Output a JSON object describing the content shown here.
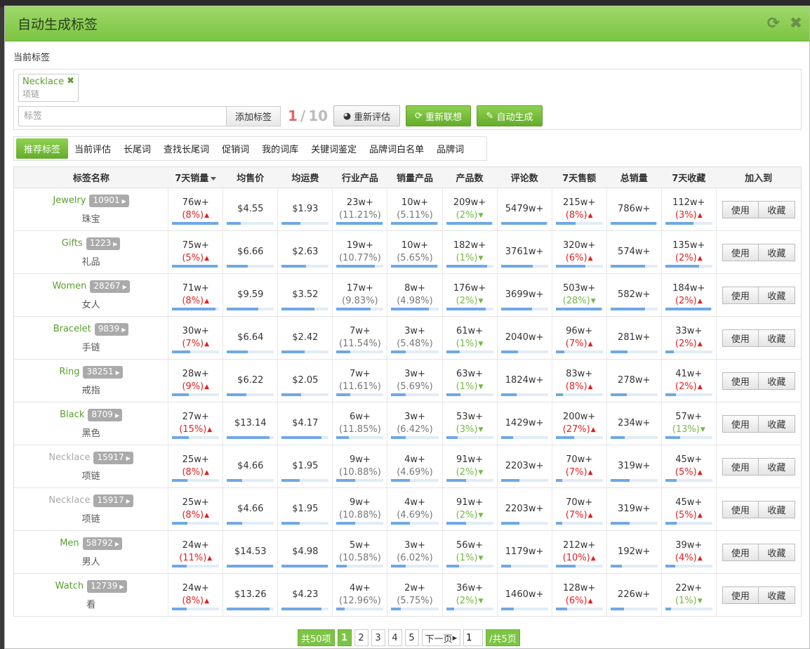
{
  "modal": {
    "title": "自动生成标签",
    "refresh_icon": "refresh-icon",
    "close_icon": "close-icon"
  },
  "current_tags": {
    "section_label": "当前标签",
    "chips": [
      {
        "en": "Necklace",
        "cn": "项链"
      }
    ],
    "input_placeholder": "标签",
    "add_button": "添加标签",
    "count_current": "1",
    "count_sep": "/",
    "count_max": "10",
    "reeval_button": "重新评估",
    "relate_button": "重新联想",
    "auto_button": "自动生成"
  },
  "tabs": [
    "推荐标签",
    "当前评估",
    "长尾词",
    "查找长尾词",
    "促销词",
    "我的词库",
    "关键词鉴定",
    "品牌词白名单",
    "品牌词"
  ],
  "active_tab": 0,
  "table": {
    "headers": [
      "标签名称",
      "7天销量",
      "均售价",
      "均运费",
      "行业产品",
      "销量产品",
      "产品数",
      "评论数",
      "7天售额",
      "总销量",
      "7天收藏",
      "加入到"
    ],
    "use_label": "使用",
    "fav_label": "收藏",
    "rows": [
      {
        "en": "Jewelry",
        "count": "10901",
        "cn": "珠宝",
        "muted": false,
        "sales7": "76w+",
        "sales7_ch": "(8%)",
        "sales7_dir": "up",
        "sales7_bar": 0.98,
        "price": "$4.55",
        "price_bar": 0.3,
        "ship": "$1.93",
        "ship_bar": 0.4,
        "ind": "23w+",
        "ind_ch": "(11.21%)",
        "ind_bar": 0.98,
        "sold": "10w+",
        "sold_ch": "(5.11%)",
        "sold_bar": 0.98,
        "prod": "209w+",
        "prod_ch": "(2%)",
        "prod_dir": "down",
        "prod_bar": 0.98,
        "reviews": "5479w+",
        "rev_bar": 0.98,
        "rev7": "215w+",
        "rev7_ch": "(8%)",
        "rev7_dir": "up",
        "rev7_bar": 0.43,
        "total": "786w+",
        "total_bar": 0.98,
        "fav": "112w+",
        "fav_ch": "(3%)",
        "fav_dir": "up",
        "fav_bar": 0.6
      },
      {
        "en": "Gifts",
        "count": "1223",
        "cn": "礼品",
        "muted": false,
        "sales7": "75w+",
        "sales7_ch": "(5%)",
        "sales7_dir": "up",
        "sales7_bar": 0.97,
        "price": "$6.66",
        "price_bar": 0.45,
        "ship": "$2.63",
        "ship_bar": 0.52,
        "ind": "19w+",
        "ind_ch": "(10.77%)",
        "ind_bar": 0.82,
        "sold": "10w+",
        "sold_ch": "(5.65%)",
        "sold_bar": 0.98,
        "prod": "182w+",
        "prod_ch": "(1%)",
        "prod_dir": "down",
        "prod_bar": 0.87,
        "reviews": "3761w+",
        "rev_bar": 0.68,
        "rev7": "320w+",
        "rev7_ch": "(6%)",
        "rev7_dir": "up",
        "rev7_bar": 0.63,
        "total": "574w+",
        "total_bar": 0.73,
        "fav": "135w+",
        "fav_ch": "(2%)",
        "fav_dir": "up",
        "fav_bar": 0.72
      },
      {
        "en": "Women",
        "count": "28267",
        "cn": "女人",
        "muted": false,
        "sales7": "71w+",
        "sales7_ch": "(8%)",
        "sales7_dir": "up",
        "sales7_bar": 0.92,
        "price": "$9.59",
        "price_bar": 0.66,
        "ship": "$3.52",
        "ship_bar": 0.7,
        "ind": "17w+",
        "ind_ch": "(9.83%)",
        "ind_bar": 0.73,
        "sold": "8w+",
        "sold_ch": "(4.98%)",
        "sold_bar": 0.8,
        "prod": "176w+",
        "prod_ch": "(2%)",
        "prod_dir": "down",
        "prod_bar": 0.84,
        "reviews": "3699w+",
        "rev_bar": 0.67,
        "rev7": "503w+",
        "rev7_ch": "(28%)",
        "rev7_dir": "down",
        "rev7_bar": 0.98,
        "total": "582w+",
        "total_bar": 0.74,
        "fav": "184w+",
        "fav_ch": "(2%)",
        "fav_dir": "up",
        "fav_bar": 0.98
      },
      {
        "en": "Bracelet",
        "count": "9839",
        "cn": "手链",
        "muted": false,
        "sales7": "30w+",
        "sales7_ch": "(7%)",
        "sales7_dir": "up",
        "sales7_bar": 0.39,
        "price": "$6.64",
        "price_bar": 0.45,
        "ship": "$2.42",
        "ship_bar": 0.48,
        "ind": "7w+",
        "ind_ch": "(11.54%)",
        "ind_bar": 0.3,
        "sold": "3w+",
        "sold_ch": "(5.48%)",
        "sold_bar": 0.3,
        "prod": "61w+",
        "prod_ch": "(1%)",
        "prod_dir": "down",
        "prod_bar": 0.29,
        "reviews": "2040w+",
        "rev_bar": 0.37,
        "rev7": "96w+",
        "rev7_ch": "(7%)",
        "rev7_dir": "up",
        "rev7_bar": 0.19,
        "total": "281w+",
        "total_bar": 0.36,
        "fav": "33w+",
        "fav_ch": "(2%)",
        "fav_dir": "up",
        "fav_bar": 0.18
      },
      {
        "en": "Ring",
        "count": "38251",
        "cn": "戒指",
        "muted": false,
        "sales7": "28w+",
        "sales7_ch": "(9%)",
        "sales7_dir": "up",
        "sales7_bar": 0.36,
        "price": "$6.22",
        "price_bar": 0.42,
        "ship": "$2.05",
        "ship_bar": 0.41,
        "ind": "7w+",
        "ind_ch": "(11.61%)",
        "ind_bar": 0.3,
        "sold": "3w+",
        "sold_ch": "(5.69%)",
        "sold_bar": 0.3,
        "prod": "63w+",
        "prod_ch": "(1%)",
        "prod_dir": "down",
        "prod_bar": 0.3,
        "reviews": "1824w+",
        "rev_bar": 0.33,
        "rev7": "83w+",
        "rev7_ch": "(8%)",
        "rev7_dir": "up",
        "rev7_bar": 0.16,
        "total": "278w+",
        "total_bar": 0.35,
        "fav": "41w+",
        "fav_ch": "(2%)",
        "fav_dir": "up",
        "fav_bar": 0.22
      },
      {
        "en": "Black",
        "count": "8709",
        "cn": "黑色",
        "muted": false,
        "sales7": "27w+",
        "sales7_ch": "(15%)",
        "sales7_dir": "up",
        "sales7_bar": 0.35,
        "price": "$13.14",
        "price_bar": 0.9,
        "ship": "$4.17",
        "ship_bar": 0.84,
        "ind": "6w+",
        "ind_ch": "(11.85%)",
        "ind_bar": 0.26,
        "sold": "3w+",
        "sold_ch": "(6.42%)",
        "sold_bar": 0.3,
        "prod": "53w+",
        "prod_ch": "(3%)",
        "prod_dir": "down",
        "prod_bar": 0.25,
        "reviews": "1429w+",
        "rev_bar": 0.26,
        "rev7": "200w+",
        "rev7_ch": "(27%)",
        "rev7_dir": "up",
        "rev7_bar": 0.4,
        "total": "234w+",
        "total_bar": 0.3,
        "fav": "57w+",
        "fav_ch": "(13%)",
        "fav_dir": "down",
        "fav_bar": 0.31
      },
      {
        "en": "Necklace",
        "count": "15917",
        "cn": "项链",
        "muted": true,
        "sales7": "25w+",
        "sales7_ch": "(8%)",
        "sales7_dir": "up",
        "sales7_bar": 0.32,
        "price": "$4.66",
        "price_bar": 0.32,
        "ship": "$1.95",
        "ship_bar": 0.39,
        "ind": "9w+",
        "ind_ch": "(10.88%)",
        "ind_bar": 0.39,
        "sold": "4w+",
        "sold_ch": "(4.69%)",
        "sold_bar": 0.4,
        "prod": "91w+",
        "prod_ch": "(2%)",
        "prod_dir": "down",
        "prod_bar": 0.43,
        "reviews": "2203w+",
        "rev_bar": 0.4,
        "rev7": "70w+",
        "rev7_ch": "(7%)",
        "rev7_dir": "up",
        "rev7_bar": 0.14,
        "total": "319w+",
        "total_bar": 0.41,
        "fav": "45w+",
        "fav_ch": "(5%)",
        "fav_dir": "up",
        "fav_bar": 0.24
      },
      {
        "en": "Necklace",
        "count": "15917",
        "cn": "项链",
        "muted": true,
        "sales7": "25w+",
        "sales7_ch": "(8%)",
        "sales7_dir": "up",
        "sales7_bar": 0.32,
        "price": "$4.66",
        "price_bar": 0.32,
        "ship": "$1.95",
        "ship_bar": 0.39,
        "ind": "9w+",
        "ind_ch": "(10.88%)",
        "ind_bar": 0.39,
        "sold": "4w+",
        "sold_ch": "(4.69%)",
        "sold_bar": 0.4,
        "prod": "91w+",
        "prod_ch": "(2%)",
        "prod_dir": "down",
        "prod_bar": 0.43,
        "reviews": "2203w+",
        "rev_bar": 0.4,
        "rev7": "70w+",
        "rev7_ch": "(7%)",
        "rev7_dir": "up",
        "rev7_bar": 0.14,
        "total": "319w+",
        "total_bar": 0.41,
        "fav": "45w+",
        "fav_ch": "(5%)",
        "fav_dir": "up",
        "fav_bar": 0.24
      },
      {
        "en": "Men",
        "count": "58792",
        "cn": "男人",
        "muted": false,
        "sales7": "24w+",
        "sales7_ch": "(11%)",
        "sales7_dir": "up",
        "sales7_bar": 0.31,
        "price": "$14.53",
        "price_bar": 0.98,
        "ship": "$4.98",
        "ship_bar": 0.98,
        "ind": "5w+",
        "ind_ch": "(10.58%)",
        "ind_bar": 0.22,
        "sold": "3w+",
        "sold_ch": "(6.02%)",
        "sold_bar": 0.3,
        "prod": "56w+",
        "prod_ch": "(1%)",
        "prod_dir": "down",
        "prod_bar": 0.27,
        "reviews": "1179w+",
        "rev_bar": 0.21,
        "rev7": "212w+",
        "rev7_ch": "(10%)",
        "rev7_dir": "up",
        "rev7_bar": 0.42,
        "total": "192w+",
        "total_bar": 0.24,
        "fav": "39w+",
        "fav_ch": "(4%)",
        "fav_dir": "up",
        "fav_bar": 0.21
      },
      {
        "en": "Watch",
        "count": "12739",
        "cn": "看",
        "muted": false,
        "sales7": "24w+",
        "sales7_ch": "(8%)",
        "sales7_dir": "up",
        "sales7_bar": 0.31,
        "price": "$13.26",
        "price_bar": 0.91,
        "ship": "$4.23",
        "ship_bar": 0.85,
        "ind": "4w+",
        "ind_ch": "(12.96%)",
        "ind_bar": 0.17,
        "sold": "2w+",
        "sold_ch": "(5.75%)",
        "sold_bar": 0.2,
        "prod": "36w+",
        "prod_ch": "(2%)",
        "prod_dir": "down",
        "prod_bar": 0.17,
        "reviews": "1460w+",
        "rev_bar": 0.27,
        "rev7": "128w+",
        "rev7_ch": "(6%)",
        "rev7_dir": "up",
        "rev7_bar": 0.25,
        "total": "226w+",
        "total_bar": 0.29,
        "fav": "22w+",
        "fav_ch": "(1%)",
        "fav_dir": "down",
        "fav_bar": 0.12
      }
    ]
  },
  "pagination": {
    "total_label": "共50项",
    "pages": [
      "1",
      "2",
      "3",
      "4",
      "5"
    ],
    "current_page": "1",
    "next_label": "下一页",
    "jump_value": "1",
    "total_pages_label": "/共5页"
  },
  "colors": {
    "accent_green": "#7cc443",
    "up_red": "#e02020",
    "down_green": "#74b843",
    "bar_blue": "#6fa8e6"
  }
}
